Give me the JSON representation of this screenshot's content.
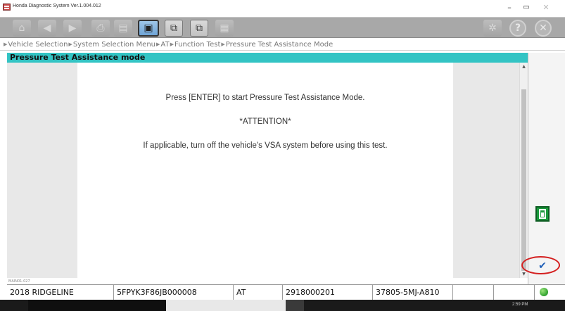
{
  "window": {
    "title": "Honda Diagnostic System Ver.1.004.012",
    "minimize_glyph": "–",
    "maximize_glyph": "▭",
    "close_glyph": "✕"
  },
  "toolbar": {
    "home_glyph": "⌂",
    "back_glyph": "◀",
    "forward_glyph": "▶",
    "print_glyph": "⎙",
    "save_glyph": "▤",
    "screen_glyph": "▣",
    "window1_glyph": "⧉",
    "window2_glyph": "⧉",
    "doc_glyph": "▦",
    "settings_glyph": "✲",
    "help_glyph": "?",
    "exit_glyph": "✕"
  },
  "breadcrumb": {
    "separator": "▶",
    "items": [
      "Vehicle Selection",
      "System Selection Menu",
      "AT",
      "Function Test",
      "Pressure Test Assistance Mode"
    ]
  },
  "header": {
    "title": "Pressure Test Assistance mode"
  },
  "content": {
    "line1": "Press [ENTER] to start Pressure Test Assistance Mode.",
    "line2": "*ATTENTION*",
    "line3": "If applicable, turn off the vehicle's VSA system before using this test.",
    "screen_id": "MAIN01-027"
  },
  "scrollbar": {
    "up_glyph": "▲",
    "down_glyph": "▼"
  },
  "side": {
    "ok_glyph": "✔"
  },
  "statusbar": {
    "model": "2018 RIDGELINE",
    "vin": "5FPYK3F86JB000008",
    "system": "AT",
    "ecu_id": "2918000201",
    "part_number": "37805-5MJ-A810",
    "field6": "",
    "field7": ""
  },
  "taskbar": {
    "clock": "2:59 PM"
  },
  "colors": {
    "header_bg": "#33c4c4",
    "toolbar_bg": "#a8a8a8",
    "exit_green": "#1a9a3c",
    "ok_blue": "#1f5fb8",
    "highlight_red": "#d42020"
  }
}
